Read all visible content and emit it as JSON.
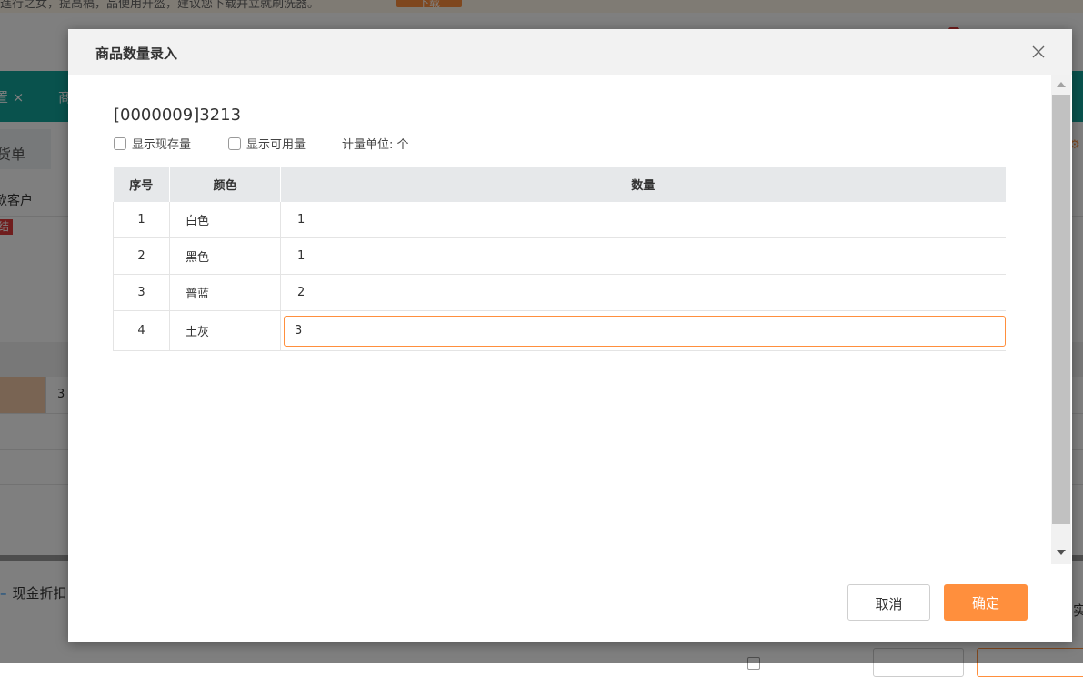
{
  "background": {
    "banner_text": "進行之女，提高稿，品便用开盔，建议您下载并立就刷洗器。",
    "banner_button": "下载",
    "tab_a": "置 ×",
    "tab_b": "商",
    "sub_tab": "货单",
    "customer_label": "款客户",
    "status_tag": "结",
    "row_value": "3",
    "discount_label": "现金折扣",
    "right_text": "实"
  },
  "modal": {
    "title": "商品数量录入",
    "product": "[0000009]3213",
    "options": {
      "show_stock": "显示现存量",
      "show_available": "显示可用量"
    },
    "unit_text": "计量单位: 个",
    "table": {
      "headers": [
        "序号",
        "颜色",
        "数量"
      ],
      "rows": [
        {
          "no": "1",
          "color": "白色",
          "qty": "1"
        },
        {
          "no": "2",
          "color": "黑色",
          "qty": "1"
        },
        {
          "no": "3",
          "color": "普蓝",
          "qty": "2"
        },
        {
          "no": "4",
          "color": "土灰",
          "qty": "3"
        }
      ]
    },
    "buttons": {
      "cancel": "取消",
      "confirm": "确定"
    }
  },
  "colors": {
    "accent": "#ff8f3d",
    "teal": "#12a59a"
  },
  "icons": [
    "close-icon",
    "checkbox-icon",
    "scroll-up-icon",
    "scroll-down-icon"
  ]
}
